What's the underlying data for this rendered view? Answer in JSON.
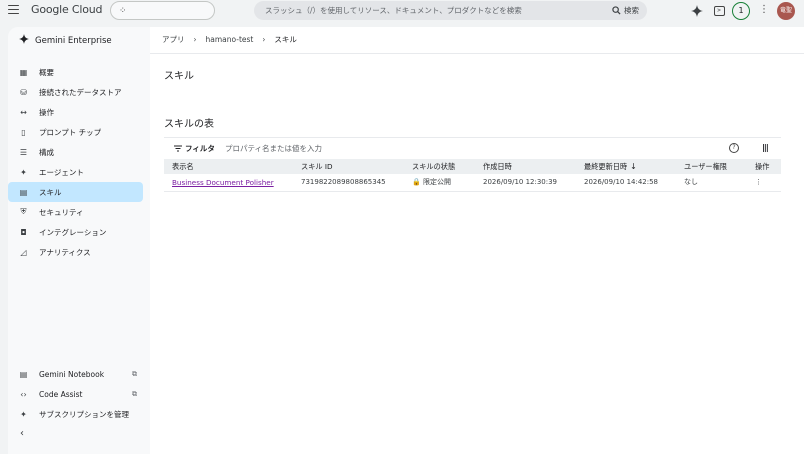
{
  "topbar": {
    "product_name": "Google Cloud",
    "search_placeholder": "スラッシュ（/）を使用してリソース、ドキュメント、プロダクトなどを検索",
    "search_button": "検索",
    "notification_count": "1",
    "avatar_initials": "竜聖"
  },
  "sidebar": {
    "header": "Gemini Enterprise",
    "items": [
      {
        "label": "概要",
        "icon": "overview-icon"
      },
      {
        "label": "接続されたデータストア",
        "icon": "datastore-icon"
      },
      {
        "label": "操作",
        "icon": "actions-icon"
      },
      {
        "label": "プロンプト チップ",
        "icon": "prompt-icon"
      },
      {
        "label": "構成",
        "icon": "config-icon"
      },
      {
        "label": "エージェント",
        "icon": "agent-icon"
      },
      {
        "label": "スキル",
        "icon": "skills-icon",
        "active": true
      },
      {
        "label": "セキュリティ",
        "icon": "shield-icon"
      },
      {
        "label": "インテグレーション",
        "icon": "integration-icon"
      },
      {
        "label": "アナリティクス",
        "icon": "analytics-icon"
      }
    ],
    "bottom_items": [
      {
        "label": "Gemini Notebook",
        "icon": "notebook-icon",
        "external": true
      },
      {
        "label": "Code Assist",
        "icon": "code-icon",
        "external": true
      },
      {
        "label": "サブスクリプションを管理",
        "icon": "sparkle-icon"
      }
    ]
  },
  "breadcrumb": {
    "items": [
      "アプリ",
      "hamano-test",
      "スキル"
    ]
  },
  "main": {
    "page_title": "スキル",
    "section_title": "スキルの表",
    "filter_label": "フィルタ",
    "filter_placeholder": "プロパティ名または値を入力",
    "table": {
      "columns": [
        "表示名",
        "スキル ID",
        "スキルの状態",
        "作成日時",
        "最終更新日時",
        "ユーザー権限",
        "操作"
      ],
      "rows": [
        {
          "name": "Business Document Polisher",
          "id": "7319822089808865345",
          "status": "限定公開",
          "created": "2026/09/10 12:30:39",
          "updated": "2026/09/10 14:42:58",
          "permission": "なし"
        }
      ]
    }
  }
}
